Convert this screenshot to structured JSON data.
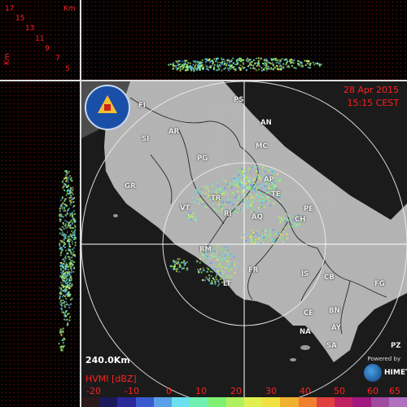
{
  "map": {
    "date": "28 Apr 2015",
    "time": "15:15 CEST",
    "range_label": "240.0Km",
    "product_label": "HVMI [dBZ]",
    "powered_by": "Powered by",
    "brand": "HIMET"
  },
  "height_axis": {
    "unit": "Km",
    "unit_vertical": "Km",
    "ticks": [
      "17",
      "15",
      "13",
      "11",
      "9",
      "7",
      "5"
    ]
  },
  "colorbar": {
    "ticks": [
      "-20",
      "-10",
      "0",
      "10",
      "20",
      "30",
      "40",
      "50",
      "60",
      "65"
    ],
    "colors": [
      "#2a1a1a",
      "#1a1a5a",
      "#2a2a9a",
      "#3a5ad0",
      "#5aa0e8",
      "#6ae0f0",
      "#70f0b0",
      "#80f070",
      "#b0f060",
      "#e0f050",
      "#f0e040",
      "#f0b030",
      "#f08030",
      "#e04040",
      "#c02060",
      "#a01880",
      "#a04aa0",
      "#b070c0"
    ]
  },
  "cities": [
    {
      "code": "PS"
    },
    {
      "code": "FI"
    },
    {
      "code": "AN"
    },
    {
      "code": "AR"
    },
    {
      "code": "SI"
    },
    {
      "code": "MC"
    },
    {
      "code": "PG"
    },
    {
      "code": "GR"
    },
    {
      "code": "AP"
    },
    {
      "code": "TE"
    },
    {
      "code": "TR"
    },
    {
      "code": "VT"
    },
    {
      "code": "RI"
    },
    {
      "code": "PE"
    },
    {
      "code": "AQ"
    },
    {
      "code": "CH"
    },
    {
      "code": "RM"
    },
    {
      "code": "FR"
    },
    {
      "code": "IS"
    },
    {
      "code": "CB"
    },
    {
      "code": "FG"
    },
    {
      "code": "LT"
    },
    {
      "code": "CE"
    },
    {
      "code": "BN"
    },
    {
      "code": "AY"
    },
    {
      "code": "NA"
    },
    {
      "code": "SA"
    },
    {
      "code": "PZ"
    }
  ],
  "colors": {
    "accent_red": "#ff2020",
    "background": "#000000"
  }
}
